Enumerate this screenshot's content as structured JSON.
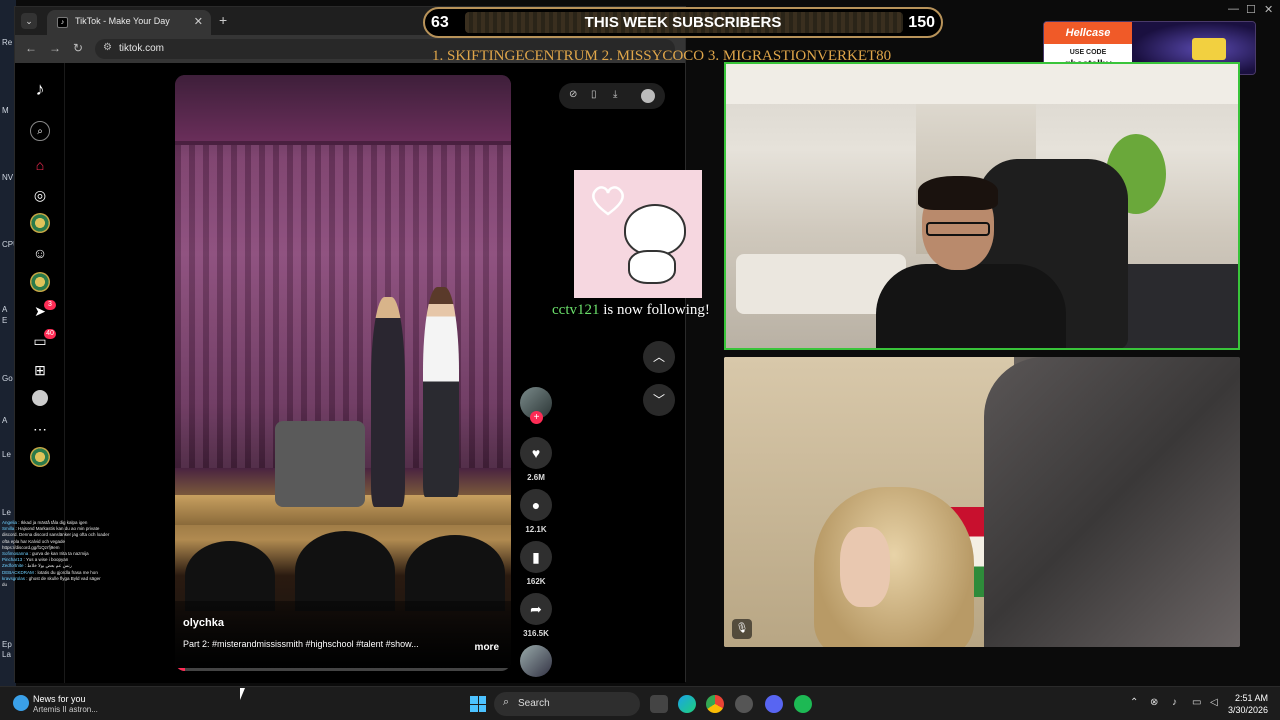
{
  "desktop": {
    "icon_labels": [
      "Re",
      "M",
      "NV",
      "CPU",
      "A",
      "E",
      "Go",
      "A",
      "Le",
      "Le",
      "Ep",
      "La"
    ]
  },
  "browser": {
    "tab_dropdown_icon": "chevron-down-icon",
    "tab_title": "TikTok - Make Your Day",
    "tab_close": "✕",
    "new_tab": "+",
    "back": "←",
    "forward": "→",
    "reload": "↻",
    "url": "tiktok.com"
  },
  "tiktok": {
    "rail_badges": {
      "messages": "3",
      "inbox": "40"
    },
    "video": {
      "username": "olychka",
      "caption": "Part 2: #misterandmississmith #highschool #talent #show...",
      "more_label": "more",
      "progress_fraction": 0.03
    },
    "actions": {
      "likes": "2.6M",
      "comments": "12.1K",
      "saves": "162K",
      "shares": "316.5K"
    }
  },
  "overlay": {
    "subs_left": "63",
    "subs_title": "THIS WEEK SUBSCRIBERS",
    "subs_right": "150",
    "ticker": "1. SKIFTINGECENTRUM  2. MISSYCOCO  3. MIGRASTIONVERKET80",
    "follow_user": "cctv121",
    "follow_text": " is now following!",
    "hellcase": {
      "brand": "Hellcase",
      "use_code": "USE CODE",
      "code": "ghostalby"
    }
  },
  "chat": [
    {
      "user": "Angelia",
      "text": "Ikkad ja mästå tåla dig kalpa igen"
    },
    {
      "user": "Smilla",
      "text": "Hajsond Markastis kan du ao min private"
    },
    {
      "user": "",
      "text": "discord. Denna discord sanslänker jag ofta och loader"
    },
    {
      "user": "",
      "text": "ofta epla har Kalvid och vegade"
    },
    {
      "user": "",
      "text": "https://discord.gg/f1Qzrfj9em"
    },
    {
      "user": "Sofimosanna",
      "text": "gurva de kan Irita ta nazmija"
    },
    {
      "user": "Pinchar13",
      "text": "Yus a wise i boopyan"
    },
    {
      "user": "Zedfortnite",
      "text": "رنس عم بعض بولا خلاط"
    },
    {
      "user": "DEBACKDRAM",
      "text": "lotatis du gjordla frasa me hon"
    },
    {
      "user": "kravsgrolas",
      "text": "ghost de skulle flyga Byld vad säger"
    },
    {
      "user": "",
      "text": "du"
    }
  ],
  "taskbar": {
    "news_title": "News for you",
    "news_sub": "Artemis II astron...",
    "search_placeholder": "Search",
    "time": "2:51 AM",
    "date": "3/30/2026"
  }
}
